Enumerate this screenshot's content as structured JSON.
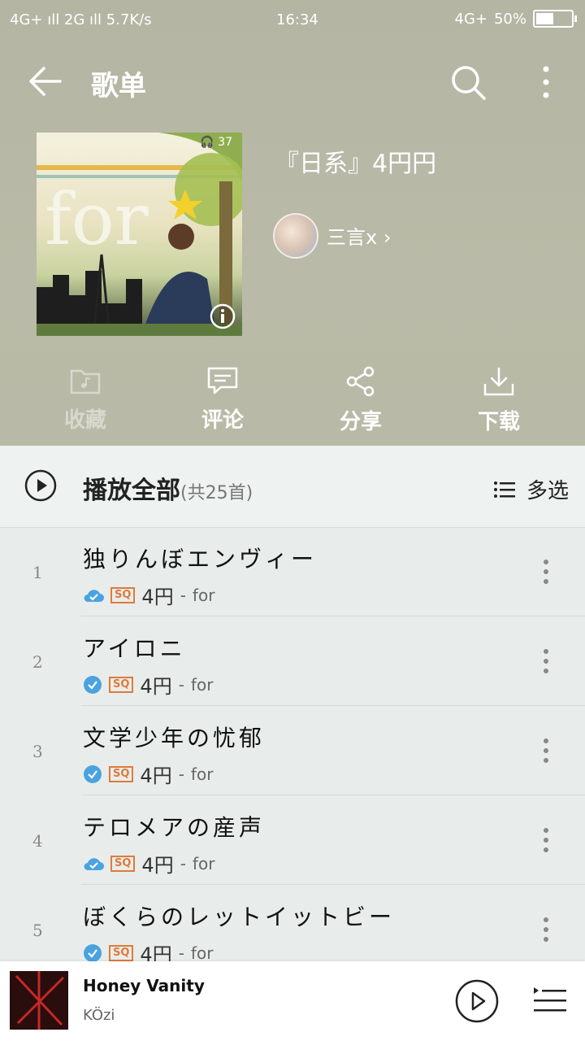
{
  "status_bar": {
    "left": "4G+ ıll 2G ıll 5.7K/s",
    "time": "16:34",
    "network": "4G+",
    "battery": "50%",
    "battery_level": 0.5
  },
  "header": {
    "title": "歌单",
    "back_icon": "back-arrow-icon",
    "search_icon": "search-icon",
    "more_icon": "more-vertical-icon"
  },
  "playlist": {
    "cover_text": "for",
    "listen_count": "37",
    "name": "『日系』4円円",
    "creator": "三言x",
    "creator_chevron": "›"
  },
  "actions": [
    {
      "label": "收藏",
      "icon": "folder-music-icon",
      "enabled": false
    },
    {
      "label": "评论",
      "icon": "comment-icon",
      "enabled": true
    },
    {
      "label": "分享",
      "icon": "share-icon",
      "enabled": true
    },
    {
      "label": "下载",
      "icon": "download-icon",
      "enabled": true
    }
  ],
  "list_header": {
    "play_all": "播放全部",
    "count": "(共25首)",
    "multi_select": "多选"
  },
  "songs": [
    {
      "index": "1",
      "title": "独りんぼエンヴィー",
      "quality": "4円",
      "separator": "-",
      "album": "for",
      "status": "cloud"
    },
    {
      "index": "2",
      "title": "アイロニ",
      "quality": "4円",
      "separator": "-",
      "album": "for",
      "status": "check"
    },
    {
      "index": "3",
      "title": "文学少年の忧郁",
      "quality": "4円",
      "separator": "-",
      "album": "for",
      "status": "check"
    },
    {
      "index": "4",
      "title": "テロメアの産声",
      "quality": "4円",
      "separator": "-",
      "album": "for",
      "status": "cloud"
    },
    {
      "index": "5",
      "title": "ぼくらのレットイットビー",
      "quality": "4円",
      "separator": "-",
      "album": "for",
      "status": "check"
    }
  ],
  "badge_sq": "SQ",
  "player": {
    "title": "Honey Vanity",
    "artist": "KÖzi"
  },
  "colors": {
    "hero_bg": "#b8b9a6",
    "list_bg": "#e8edeb",
    "accent_blue": "#4aa3e0",
    "badge_orange": "#e07a3a"
  }
}
